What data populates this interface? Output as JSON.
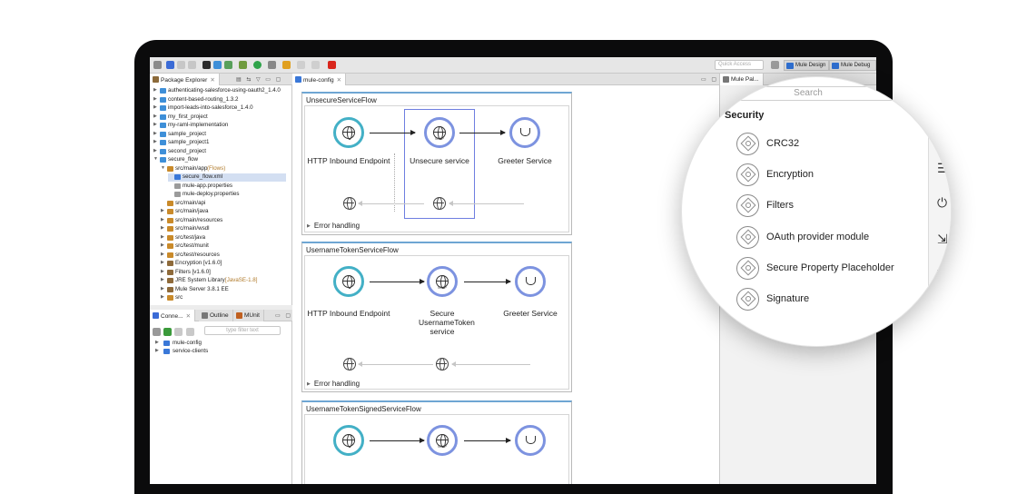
{
  "toolbar": {
    "quick_access": "Quick Access",
    "perspectives": [
      "Mule Design",
      "Mule Debug"
    ]
  },
  "package_explorer": {
    "tab_label": "Package Explorer",
    "items": [
      {
        "label": "authenticating-salesforce-using-oauth2_1.4.0",
        "annot": ""
      },
      {
        "label": "content-based-routing_1.3.2",
        "annot": ""
      },
      {
        "label": "import-leads-into-salesforce_1.4.0",
        "annot": ""
      },
      {
        "label": "my_first_project",
        "annot": ""
      },
      {
        "label": "my-raml-implementation",
        "annot": ""
      },
      {
        "label": "sample_project",
        "annot": ""
      },
      {
        "label": "sample_project1",
        "annot": ""
      },
      {
        "label": "second_project",
        "annot": ""
      },
      {
        "label": "secure_flow",
        "annot": ""
      },
      {
        "label": "src/main/app",
        "annot": " (Flows)"
      },
      {
        "label": "secure_flow.xml",
        "annot": ""
      },
      {
        "label": "mule-app.properties",
        "annot": ""
      },
      {
        "label": "mule-deploy.properties",
        "annot": ""
      },
      {
        "label": "src/main/api",
        "annot": ""
      },
      {
        "label": "src/main/java",
        "annot": ""
      },
      {
        "label": "src/main/resources",
        "annot": ""
      },
      {
        "label": "src/main/wsdl",
        "annot": ""
      },
      {
        "label": "src/test/java",
        "annot": ""
      },
      {
        "label": "src/test/munit",
        "annot": ""
      },
      {
        "label": "src/test/resources",
        "annot": ""
      },
      {
        "label": "Encryption [v1.6.0]",
        "annot": ""
      },
      {
        "label": "Filters [v1.6.0]",
        "annot": ""
      },
      {
        "label": "JRE System Library",
        "annot": " [JavaSE-1.8]"
      },
      {
        "label": "Mule Server 3.8.1 EE",
        "annot": ""
      },
      {
        "label": "src",
        "annot": ""
      }
    ]
  },
  "connections": {
    "tabs": [
      "Conne...",
      "Outline",
      "MUnit"
    ],
    "filter_placeholder": "type filter text",
    "items": [
      "mule-config",
      "service-clients"
    ]
  },
  "editor": {
    "tab_label": "mule-config",
    "flows": [
      {
        "title": "UnsecureServiceFlow",
        "nodes": [
          "HTTP Inbound Endpoint",
          "Unsecure service",
          "Greeter Service"
        ],
        "error_handling": "Error handling"
      },
      {
        "title": "UsernameTokenServiceFlow",
        "nodes": [
          "HTTP Inbound Endpoint",
          "Secure UsernameToken service",
          "Greeter Service"
        ],
        "error_handling": "Error handling"
      },
      {
        "title": "UsernameTokenSignedServiceFlow",
        "nodes": []
      }
    ]
  },
  "palette": {
    "tab_label": "Mule Pal...",
    "search_placeholder": "Search",
    "section_title": "Security",
    "items": [
      "CRC32",
      "Encryption",
      "Filters",
      "OAuth provider module",
      "Secure Property Placeholder",
      "Signature"
    ]
  }
}
